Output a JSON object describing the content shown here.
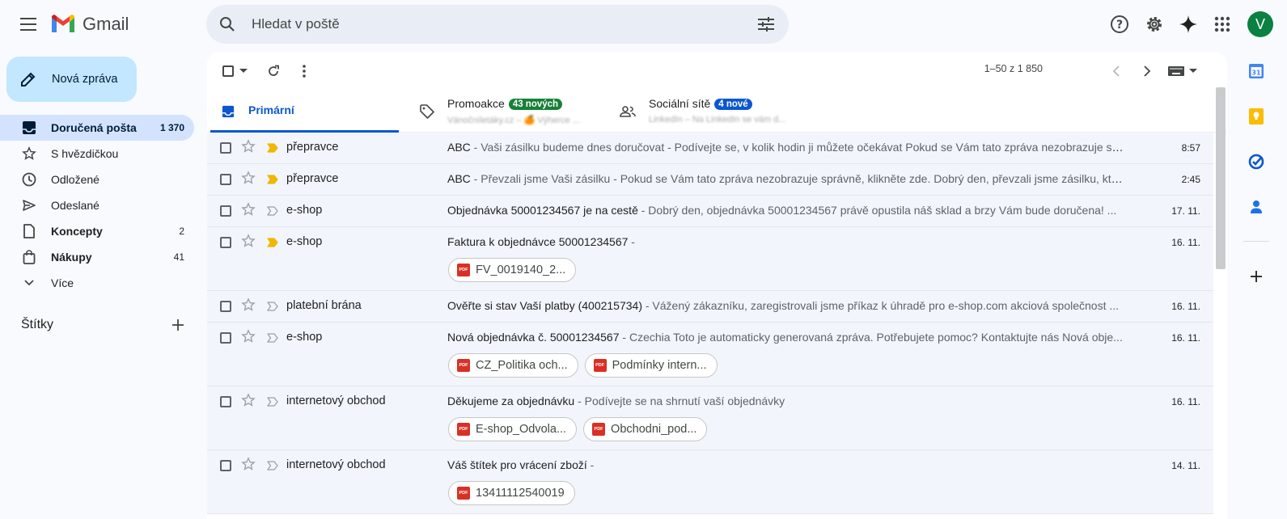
{
  "app": {
    "logo_text": "Gmail"
  },
  "search": {
    "placeholder": "Hledat v poště"
  },
  "user": {
    "avatar_letter": "V"
  },
  "compose": {
    "label": "Nová zpráva"
  },
  "nav": {
    "items": [
      {
        "label": "Doručená pošta",
        "count": "1 370",
        "icon": "inbox-icon"
      },
      {
        "label": "S hvězdičkou",
        "count": "",
        "icon": "star-icon"
      },
      {
        "label": "Odložené",
        "count": "",
        "icon": "clock-icon"
      },
      {
        "label": "Odeslané",
        "count": "",
        "icon": "send-icon"
      },
      {
        "label": "Koncepty",
        "count": "2",
        "icon": "draft-icon"
      },
      {
        "label": "Nákupy",
        "count": "41",
        "icon": "shopping-bag-icon"
      },
      {
        "label": "Více",
        "count": "",
        "icon": "chevron-down-icon"
      }
    ],
    "labels_title": "Štítky"
  },
  "toolbar": {
    "pager": "1–50 z 1 850"
  },
  "tabs": [
    {
      "label": "Primární"
    },
    {
      "label": "Promoakce",
      "badge": "43 nových",
      "badge_color": "#188038",
      "snippet": "Vánočníletáky.cz – 🍊 Výherce ..."
    },
    {
      "label": "Sociální sítě",
      "badge": "4 nové",
      "badge_color": "#0b57d0",
      "snippet": "LinkedIn – Na LinkedIn se vám d..."
    }
  ],
  "emails": [
    {
      "sender": "přepravce",
      "important": true,
      "subject": "ABC",
      "snippet": " - Vaši zásilku budeme dnes doručovat - Podívejte se, v kolik hodin ji můžete očekávat Pokud se Vám tato zpráva nezobrazuje spr...",
      "date": "8:57",
      "attachments": []
    },
    {
      "sender": "přepravce",
      "important": true,
      "subject": "ABC",
      "snippet": " - Převzali jsme Vaši zásilku - Pokud se Vám tato zpráva nezobrazuje správně, klikněte zde. Dobrý den, převzali jsme zásilku, kter...",
      "date": "2:45",
      "attachments": []
    },
    {
      "sender": "e-shop",
      "important": false,
      "subject": "Objednávka 50001234567 je na cestě",
      "snippet": " - Dobrý den, objednávka 50001234567 právě opustila náš sklad a brzy Vám bude doručena! ...",
      "date": "17. 11.",
      "attachments": []
    },
    {
      "sender": "e-shop",
      "important": true,
      "subject": "Faktura k objednávce 50001234567",
      "snippet": " -",
      "date": "16. 11.",
      "attachments": [
        "FV_0019140_2..."
      ]
    },
    {
      "sender": "platební brána",
      "important": false,
      "subject": "Ověřte si stav Vaší platby (400215734)",
      "snippet": " - Vážený zákazníku, zaregistrovali jsme příkaz k úhradě pro e-shop.com akciová společnost ...",
      "date": "16. 11.",
      "attachments": []
    },
    {
      "sender": "e-shop",
      "important": false,
      "subject": "Nová objednávka č. 50001234567",
      "snippet": " - Czechia Toto je automaticky generovaná zpráva. Potřebujete pomoc? Kontaktujte nás Nová obje...",
      "date": "16. 11.",
      "attachments": [
        "CZ_Politika och...",
        "Podmínky intern..."
      ]
    },
    {
      "sender": "internetový obchod",
      "important": false,
      "subject": "Děkujeme za objednávku",
      "snippet": " - Podívejte se na shrnutí vaší objednávky",
      "date": "16. 11.",
      "attachments": [
        "E-shop_Odvola...",
        "Obchodni_pod..."
      ]
    },
    {
      "sender": "internetový obchod",
      "important": false,
      "subject": "Váš štítek pro vrácení zboží",
      "snippet": " -",
      "date": "14. 11.",
      "attachments": [
        "13411112540019"
      ]
    }
  ]
}
